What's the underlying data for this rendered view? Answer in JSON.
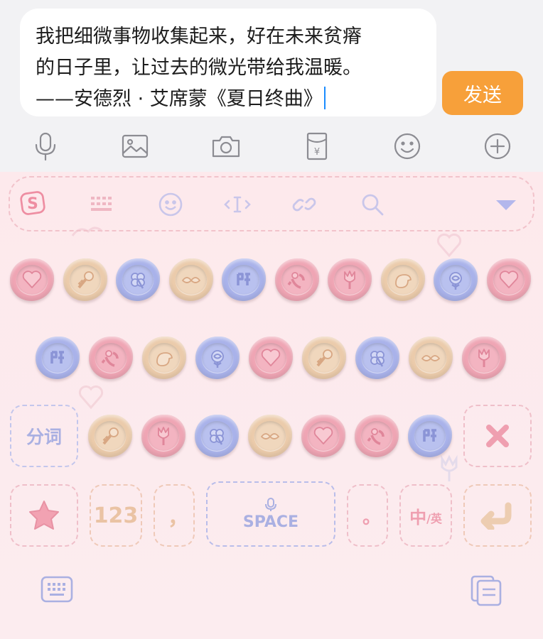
{
  "input": {
    "lines": [
      "我把细微事物收集起来，好在未来贫瘠",
      "的日子里，让过去的微光带给我温暖。",
      "——安德烈 · 艾席蒙《夏日终曲》"
    ],
    "send_label": "发送"
  },
  "toolbar_icons": [
    "microphone-icon",
    "image-icon",
    "camera-icon",
    "red-packet-icon",
    "emoji-icon",
    "plus-icon"
  ],
  "keyboard": {
    "top_icons": [
      "sogou-logo-icon",
      "keyboard-grid-icon",
      "emoji-icon",
      "cursor-move-icon",
      "link-icon",
      "search-icon",
      "collapse-arrow-icon"
    ],
    "row1": [
      {
        "color": "pink",
        "icon": "heart"
      },
      {
        "color": "peach",
        "icon": "key"
      },
      {
        "color": "lavender",
        "icon": "clover"
      },
      {
        "color": "peach",
        "icon": "mustache"
      },
      {
        "color": "lavender",
        "icon": "glyph"
      },
      {
        "color": "pink",
        "icon": "cupid"
      },
      {
        "color": "pink",
        "icon": "tulip"
      },
      {
        "color": "peach",
        "icon": "bird"
      },
      {
        "color": "lavender",
        "icon": "rose"
      },
      {
        "color": "pink",
        "icon": "heart"
      }
    ],
    "row2": [
      {
        "color": "lavender",
        "icon": "glyph"
      },
      {
        "color": "pink",
        "icon": "cupid"
      },
      {
        "color": "peach",
        "icon": "bird"
      },
      {
        "color": "lavender",
        "icon": "rose"
      },
      {
        "color": "pink",
        "icon": "heart"
      },
      {
        "color": "peach",
        "icon": "key"
      },
      {
        "color": "lavender",
        "icon": "clover"
      },
      {
        "color": "peach",
        "icon": "mustache"
      },
      {
        "color": "pink",
        "icon": "tulip"
      }
    ],
    "row3": [
      {
        "color": "peach",
        "icon": "key"
      },
      {
        "color": "pink",
        "icon": "tulip"
      },
      {
        "color": "lavender",
        "icon": "clover"
      },
      {
        "color": "peach",
        "icon": "mustache"
      },
      {
        "color": "pink",
        "icon": "heart"
      },
      {
        "color": "pink",
        "icon": "cupid"
      },
      {
        "color": "lavender",
        "icon": "glyph"
      }
    ],
    "segment_label": "分词",
    "numbers_label": "123",
    "comma_label": "，",
    "space_label": "SPACE",
    "period_label": "。",
    "lang_zh": "中",
    "lang_en": "/英"
  },
  "colors": {
    "accent": "#f7a03a",
    "keyboard_bg": "#fcecee",
    "pink": "#efa5b4",
    "peach": "#ebcbab",
    "lavender": "#a9b2ea"
  }
}
